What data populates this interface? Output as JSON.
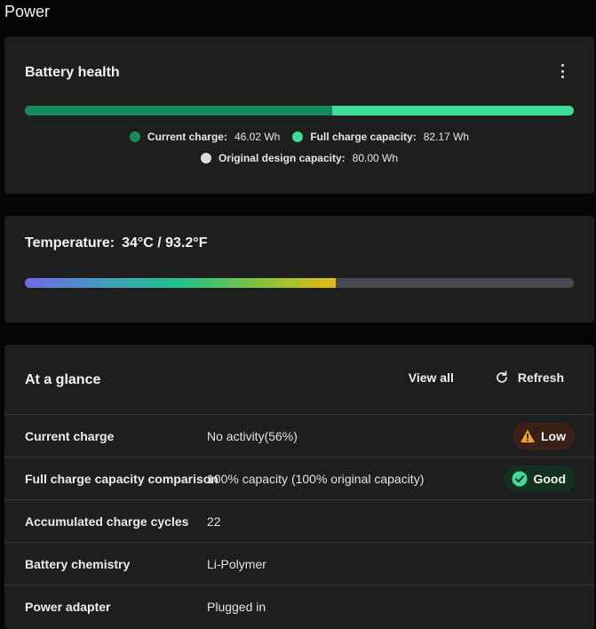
{
  "page": {
    "title": "Power"
  },
  "battery_health": {
    "title": "Battery health",
    "current_charge_wh": 46.02,
    "full_charge_capacity_wh": 82.17,
    "legend": [
      {
        "label": "Current charge:",
        "value": "46.02 Wh",
        "color": "#168a5c"
      },
      {
        "label": "Full charge capacity:",
        "value": "82.17 Wh",
        "color": "#3ddc97"
      },
      {
        "label": "Original design capacity:",
        "value": "80.00 Wh",
        "color": "#d9dde2"
      }
    ]
  },
  "temperature": {
    "label": "Temperature:",
    "value": "34°C / 93.2°F",
    "level_fraction": 0.566
  },
  "glance": {
    "title": "At a glance",
    "view_all": "View all",
    "refresh": "Refresh",
    "rows": [
      {
        "label": "Current charge",
        "value": "No activity(56%)",
        "badge": {
          "text": "Low",
          "kind": "low"
        }
      },
      {
        "label": "Full charge capacity comparison",
        "value": "100% capacity (100% original capacity)",
        "badge": {
          "text": "Good",
          "kind": "good"
        }
      },
      {
        "label": "Accumulated charge cycles",
        "value": "22"
      },
      {
        "label": "Battery chemistry",
        "value": "Li-Polymer"
      },
      {
        "label": "Power adapter",
        "value": "Plugged in"
      }
    ]
  }
}
